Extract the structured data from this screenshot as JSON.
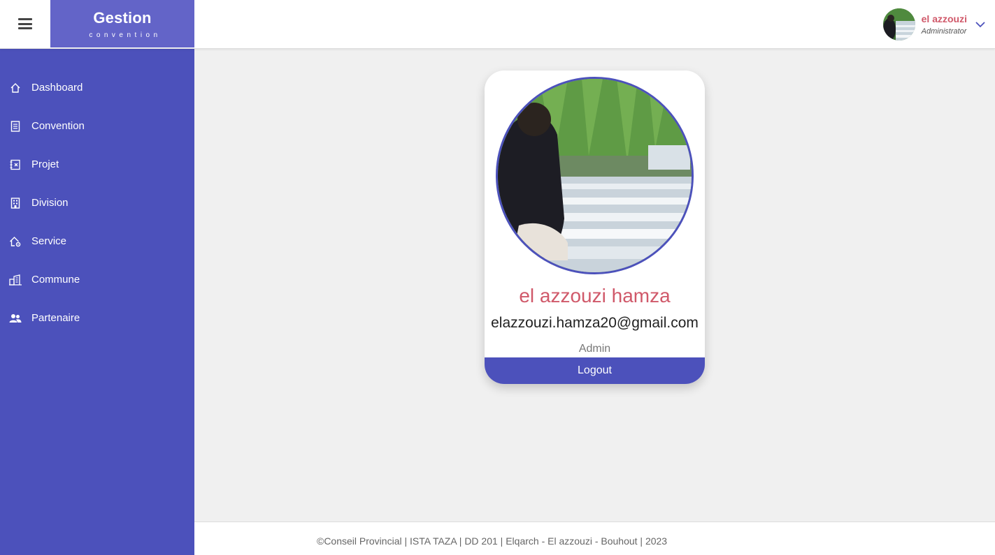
{
  "header": {
    "brand_title": "Gestion",
    "brand_subtitle": "convention",
    "user": {
      "name": "el azzouzi",
      "role": "Administrator"
    }
  },
  "sidebar": {
    "items": [
      {
        "label": "Dashboard",
        "icon": "home-icon"
      },
      {
        "label": "Convention",
        "icon": "document-icon"
      },
      {
        "label": "Projet",
        "icon": "receipt-icon"
      },
      {
        "label": "Division",
        "icon": "building-icon"
      },
      {
        "label": "Service",
        "icon": "house-gear-icon"
      },
      {
        "label": "Commune",
        "icon": "city-icon"
      },
      {
        "label": "Partenaire",
        "icon": "users-icon"
      }
    ]
  },
  "profile": {
    "full_name": "el azzouzi hamza",
    "email": "elazzouzi.hamza20@gmail.com",
    "role": "Admin",
    "logout_label": "Logout"
  },
  "footer": {
    "text": "©Conseil Provincial | ISTA TAZA | DD 201 | Elqarch - El azzouzi - Bouhout | 2023"
  },
  "colors": {
    "sidebar": "#4c51bb",
    "brand": "#6364c8",
    "accent_name": "#d0596a",
    "background": "#f0f0f0"
  }
}
